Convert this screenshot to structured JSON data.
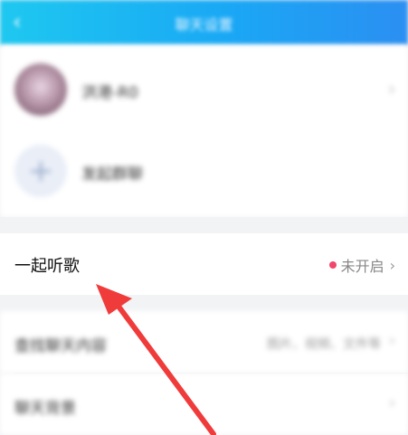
{
  "header": {
    "back_icon": "chevron-left-icon",
    "title": "聊天设置"
  },
  "members": {
    "name": "洪港-R0",
    "add_label": "发起群聊",
    "add_icon": "plus-icon"
  },
  "listen_together": {
    "label": "一起听歌",
    "status": "未开启",
    "status_color": "#f2466b"
  },
  "search_chat": {
    "label": "查找聊天内容",
    "hint": "图片、视频、文件等"
  },
  "chat_background": {
    "label": "聊天背景"
  },
  "annotation": {
    "arrow_color": "#f03b3b"
  }
}
